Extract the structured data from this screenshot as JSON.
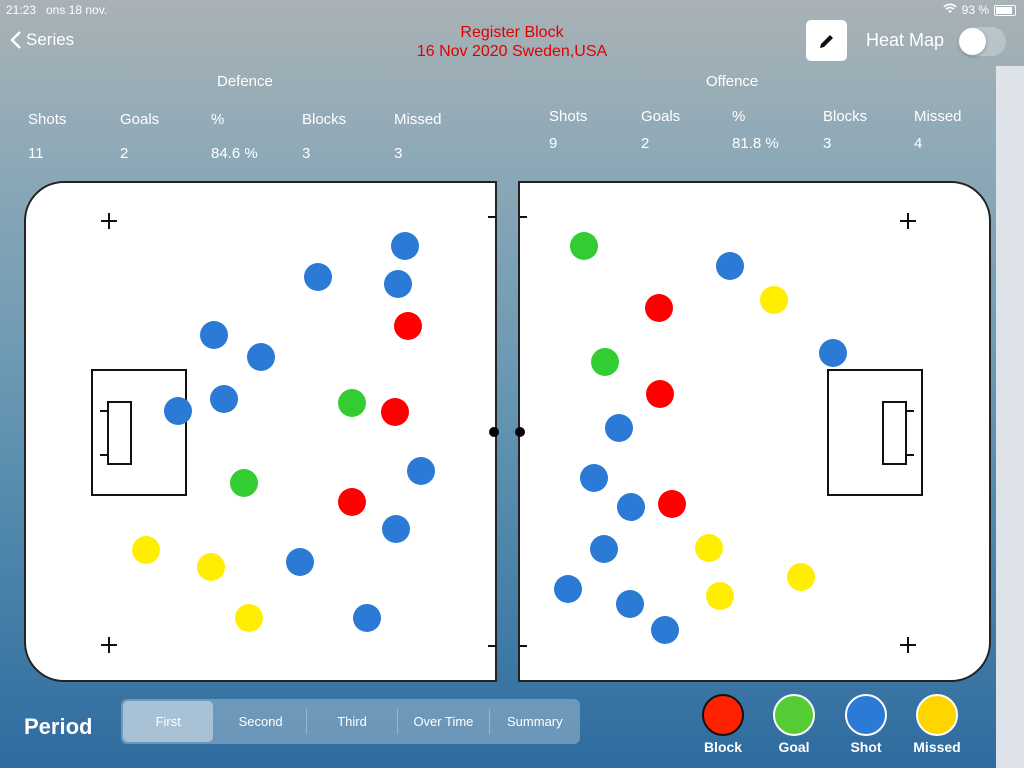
{
  "status": {
    "time": "21:23",
    "date": "ons 18 nov.",
    "battery": "93 %"
  },
  "nav": {
    "back_label": "Series",
    "title_line1": "Register Block",
    "title_line2": "16 Nov 2020  Sweden,USA",
    "heatmap_label": "Heat Map",
    "heatmap_on": false
  },
  "defence": {
    "title": "Defence",
    "headers": [
      "Shots",
      "Goals",
      "%",
      "Blocks",
      "Missed"
    ],
    "values": [
      "11",
      "2",
      "84.6 %",
      "3",
      "3"
    ]
  },
  "offence": {
    "title": "Offence",
    "headers": [
      "Shots",
      "Goals",
      "%",
      "Blocks",
      "Missed"
    ],
    "values": [
      "9",
      "2",
      "81.8 %",
      "3",
      "4"
    ]
  },
  "colors": {
    "block": "#ff0000",
    "goal": "#33cc33",
    "shot": "#2a7ad6",
    "missed": "#ffee00"
  },
  "period": {
    "label": "Period",
    "tabs": [
      "First",
      "Second",
      "Third",
      "Over Time",
      "Summary"
    ],
    "selected": "First"
  },
  "legend": [
    {
      "label": "Block",
      "color": "#ff2200"
    },
    {
      "label": "Goal",
      "color": "#55cc33"
    },
    {
      "label": "Shot",
      "color": "#2a7ad6"
    },
    {
      "label": "Missed",
      "color": "#ffd500"
    }
  ]
}
